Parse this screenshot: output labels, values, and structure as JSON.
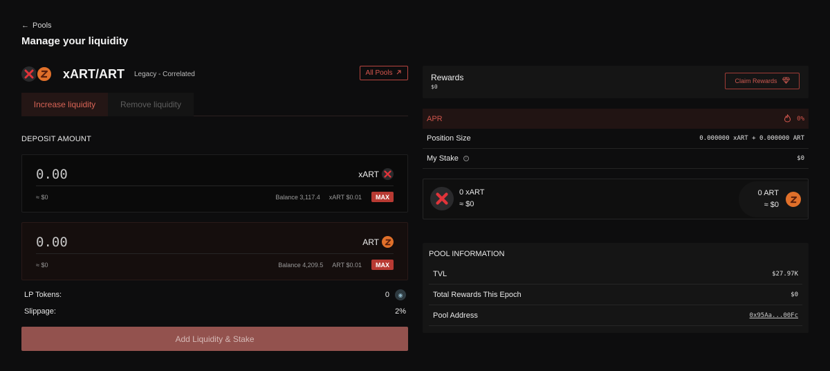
{
  "nav": {
    "back_label": "Pools"
  },
  "page": {
    "title": "Manage your liquidity"
  },
  "pair": {
    "name": "xART/ART",
    "type": "Legacy - Correlated",
    "all_pools_label": "All Pools"
  },
  "tabs": [
    {
      "label": "Increase liquidity",
      "active": true
    },
    {
      "label": "Remove liquidity",
      "active": false
    }
  ],
  "deposit": {
    "label": "DEPOSIT AMOUNT",
    "inputs": [
      {
        "amount": "0.00",
        "token": "xART",
        "usd": "≈ $0",
        "balance": "Balance 3,117.4",
        "price": "xART $0.01",
        "max_label": "MAX"
      },
      {
        "amount": "0.00",
        "token": "ART",
        "usd": "≈ $0",
        "balance": "Balance 4,209.5",
        "price": "ART $0.01",
        "max_label": "MAX"
      }
    ]
  },
  "lp_tokens": {
    "label": "LP Tokens:",
    "value": "0"
  },
  "slippage": {
    "label": "Slippage:",
    "value": "2%"
  },
  "add_button_label": "Add Liquidity & Stake",
  "rewards": {
    "title": "Rewards",
    "value": "$0",
    "claim_label": "Claim Rewards"
  },
  "stats": {
    "apr_label": "APR",
    "apr_value": "0%",
    "position_label": "Position Size",
    "position_value": "0.000000 xART + 0.000000 ART",
    "stake_label": "My Stake",
    "stake_value": "$0"
  },
  "position": {
    "left_amount": "0 xART",
    "left_usd": "≈ $0",
    "right_amount": "0 ART",
    "right_usd": "≈ $0"
  },
  "pool_info": {
    "title": "POOL INFORMATION",
    "rows": [
      {
        "label": "TVL",
        "value": "$27.97K"
      },
      {
        "label": "Total Rewards This Epoch",
        "value": "$0"
      },
      {
        "label": "Pool Address",
        "value": "0x95Aa...00Fc"
      }
    ]
  },
  "colors": {
    "accent": "#d8574f",
    "max": "#b83a33",
    "add_button": "#93524e",
    "art_coin": "#e0702a"
  },
  "icons": [
    "arrow-left-icon",
    "external-link-icon",
    "xart-token-icon",
    "art-token-icon",
    "gem-icon",
    "flame-icon",
    "info-icon",
    "lp-token-icon"
  ]
}
